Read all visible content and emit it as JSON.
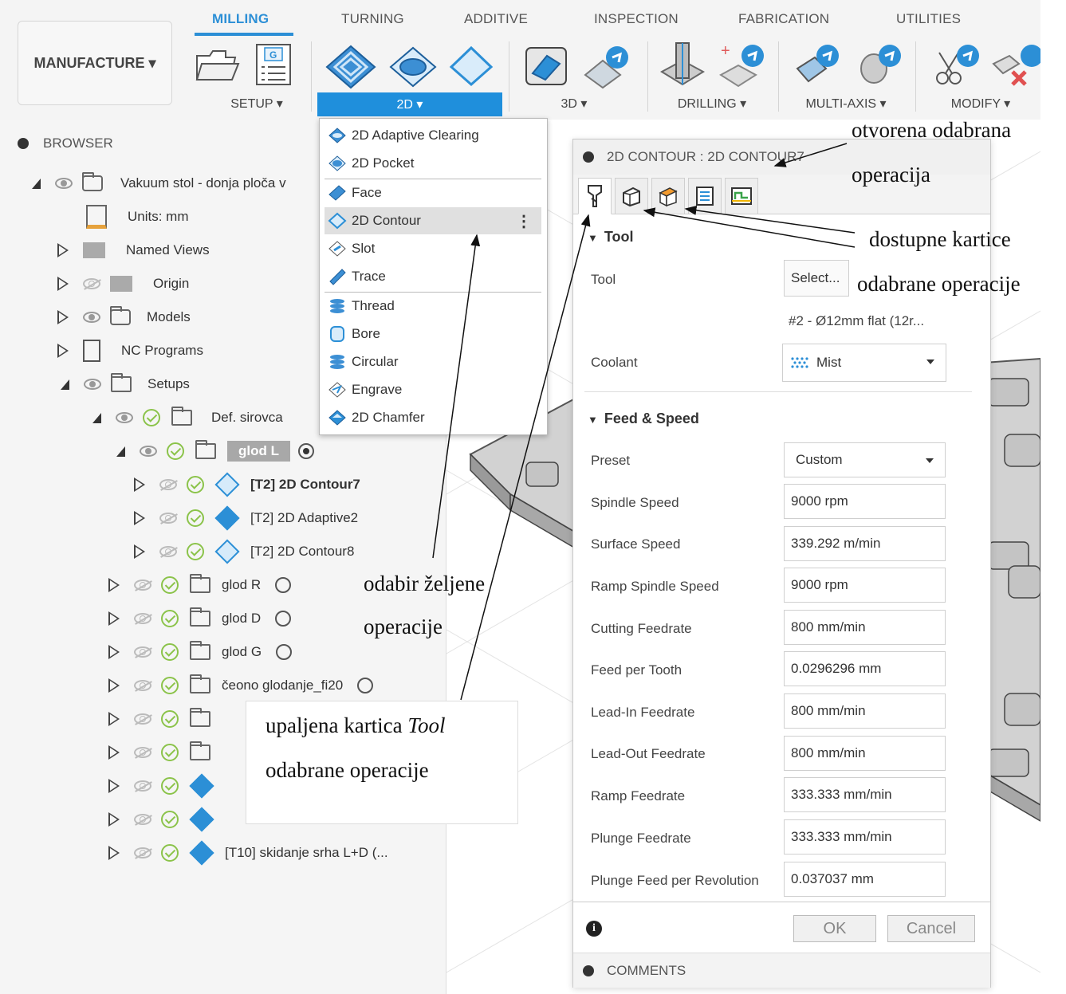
{
  "toolbar": {
    "workspace": "MANUFACTURE ▾",
    "tabs": [
      "MILLING",
      "TURNING",
      "ADDITIVE",
      "INSPECTION",
      "FABRICATION",
      "UTILITIES"
    ],
    "groups": {
      "setup": "SETUP ▾",
      "2d": "2D ▾",
      "3d": "3D ▾",
      "drilling": "DRILLING ▾",
      "multiaxis": "MULTI-AXIS ▾",
      "modify": "MODIFY ▾"
    },
    "accent": "#2c8fd6"
  },
  "browser": {
    "title": "BROWSER",
    "root": "Vakuum stol - donja ploča v",
    "items": [
      {
        "label": "Units: mm"
      },
      {
        "label": "Named Views"
      },
      {
        "label": "Origin"
      },
      {
        "label": "Models"
      },
      {
        "label": "NC Programs"
      },
      {
        "label": "Setups"
      },
      {
        "label": "Def. sirovca"
      },
      {
        "label": "glod L"
      },
      {
        "label": "[T2] 2D Contour7"
      },
      {
        "label": "[T2] 2D Adaptive2"
      },
      {
        "label": "[T2] 2D Contour8"
      },
      {
        "label": "glod R"
      },
      {
        "label": "glod D"
      },
      {
        "label": "glod G"
      },
      {
        "label": "čeono glodanje_fi20"
      },
      {
        "label": "[T10] skidanje srha L+D (..."
      }
    ]
  },
  "dropdown": {
    "items": [
      "2D Adaptive Clearing",
      "2D Pocket",
      "Face",
      "2D Contour",
      "Slot",
      "Trace",
      "Thread",
      "Bore",
      "Circular",
      "Engrave",
      "2D Chamfer"
    ],
    "more": "⋮"
  },
  "dialog": {
    "title": "2D CONTOUR : 2D CONTOUR7",
    "tool_section": "Tool",
    "tool_label": "Tool",
    "tool_button": "Select...",
    "tool_value": "#2 - Ø12mm flat (12r...",
    "coolant_label": "Coolant",
    "coolant_value": "Mist",
    "feed_section": "Feed & Speed",
    "rows": [
      {
        "label": "Preset",
        "value": "Custom"
      },
      {
        "label": "Spindle Speed",
        "value": "9000 rpm"
      },
      {
        "label": "Surface Speed",
        "value": "339.292 m/min"
      },
      {
        "label": "Ramp Spindle Speed",
        "value": "9000 rpm"
      },
      {
        "label": "Cutting Feedrate",
        "value": "800 mm/min"
      },
      {
        "label": "Feed per Tooth",
        "value": "0.0296296 mm"
      },
      {
        "label": "Lead-In Feedrate",
        "value": "800 mm/min"
      },
      {
        "label": "Lead-Out Feedrate",
        "value": "800 mm/min"
      },
      {
        "label": "Ramp Feedrate",
        "value": "333.333 mm/min"
      },
      {
        "label": "Plunge Feedrate",
        "value": "333.333 mm/min"
      },
      {
        "label": "Plunge Feed per Revolution",
        "value": "0.037037 mm"
      }
    ],
    "ok": "OK",
    "cancel": "Cancel",
    "comments": "COMMENTS"
  },
  "annotations": {
    "open_op_1": "otvorena odabrana",
    "open_op_2": "operacija",
    "tabs_1": "dostupne kartice",
    "tabs_2": "odabrane operacije",
    "choose_1": "odabir željene",
    "choose_2": "operacije",
    "tool_tab_1": "upaljena kartica ",
    "tool_tab_em": "Tool",
    "tool_tab_2": "odabrane operacije"
  }
}
